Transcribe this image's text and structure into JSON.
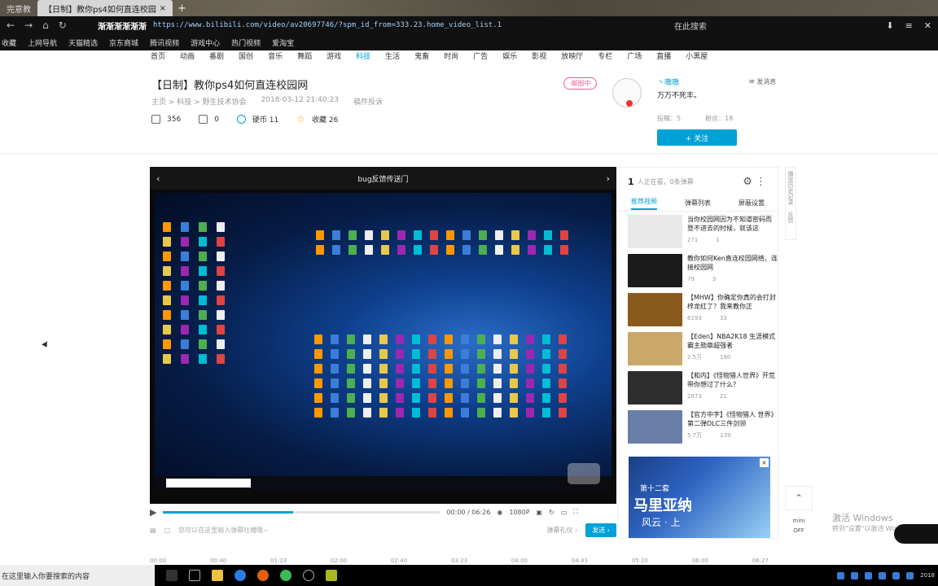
{
  "browser": {
    "tab_left": "完意教",
    "tab_active": "【日制】教你ps4如何直连校园网_科",
    "tab_close": "×",
    "new_tab": "+",
    "url_brand": "渐渐渐渐渐渐",
    "url": "https://www.bilibili.com/video/av20697746/?spm_id_from=333.23.home_video_list.1",
    "search_placeholder": "在此搜索",
    "nav_icons": [
      "←",
      "→",
      "⌂",
      "↻"
    ],
    "right_icons": [
      "⬇",
      "≡",
      "✕"
    ],
    "bookmarks": [
      "收藏",
      "上网导航",
      "天猫精选",
      "京东商城",
      "腾讯视频",
      "游戏中心",
      "热门视频",
      "爱淘宝"
    ]
  },
  "site": {
    "categories": [
      "首页",
      "动画",
      "番剧",
      "国创",
      "音乐",
      "舞蹈",
      "游戏",
      "科技",
      "生活",
      "鬼畜",
      "时尚",
      "广告",
      "娱乐",
      "影视",
      "放映厅",
      "专栏",
      "广场",
      "直播",
      "小黑屋"
    ],
    "active_category": "科技"
  },
  "video": {
    "title": "【日制】教你ps4如何直连校园网",
    "breadcrumb": "主页 > 科技 > 野生技术协会",
    "date": "2018-03-12 21:40:23",
    "report": "稿件投诉",
    "views": "356",
    "danmaku": "0",
    "coins_label": "硬币 11",
    "fav_label": "收藏 26",
    "status_badge": "·邮图中"
  },
  "uploader": {
    "name": "丶嗷嗷",
    "signature": "万万不死丰。",
    "send_msg": "发消息",
    "posts": "投稿：5",
    "fans": "粉丝：18",
    "follow": "+ 关注"
  },
  "player": {
    "top_title": "bug反馈传送门",
    "prev": "‹",
    "next": "›",
    "time": "00:00 / 06:26",
    "quality": "1080P",
    "danmaku_placeholder": "您可以在这里输入弹幕吐槽哦~",
    "danmaku_etiquette": "弹幕礼仪 ›",
    "send": "发送 ›"
  },
  "timeline": [
    "00:00",
    "00:40",
    "01:23",
    "02:00",
    "02:40",
    "03:23",
    "04:00",
    "04:43",
    "05:20",
    "06:00",
    "06:27"
  ],
  "sidebar": {
    "online_count": "1",
    "online_text": "人正在看，0条弹幕",
    "tabs": [
      "推荐视频",
      "弹幕列表",
      "屏蔽设置"
    ],
    "items": [
      {
        "title": "当你校园网因为不知道密码而登不进去的时候，就该这",
        "views": "271",
        "danmaku": "1",
        "color": "#e9e9e9"
      },
      {
        "title": "教你如何Ken直连校园网络，连接校园网",
        "views": "79",
        "danmaku": "3",
        "color": "#1b1b1b"
      },
      {
        "title": "【MHW】你确定你真的会打封梓龙红了？我来教你正",
        "views": "6193",
        "danmaku": "33",
        "color": "#8a5a1c"
      },
      {
        "title": "【Eden】NBA2K18 生涯模式 霸主勋章超强者",
        "views": "2.5万",
        "danmaku": "180",
        "color": "#c9a86a"
      },
      {
        "title": "【和内】《怪物猎人世界》开荒带你想过了什么?",
        "views": "2873",
        "danmaku": "21",
        "color": "#2d2d2d"
      },
      {
        "title": "【官方中字】《怪物猎人 世界》第二弹DLC三件剑领",
        "views": "5.7万",
        "danmaku": "139",
        "color": "#6a7fa8"
      }
    ],
    "ad": {
      "line1": "第十二套",
      "line2": "马里亚纳",
      "line3": "风云 · 上",
      "close": "×"
    }
  },
  "rightbar": {
    "labels": [
      "播放历史记录",
      "反馈"
    ],
    "scroll_top": "⌃",
    "mini": "mini",
    "mini_state": "OFF"
  },
  "os": {
    "search": "在这里输入你要搜索的内容",
    "watermark_line1": "激活 Windows",
    "watermark_line2": "转到\"设置\"以激活 Windows",
    "clock": "2018"
  }
}
